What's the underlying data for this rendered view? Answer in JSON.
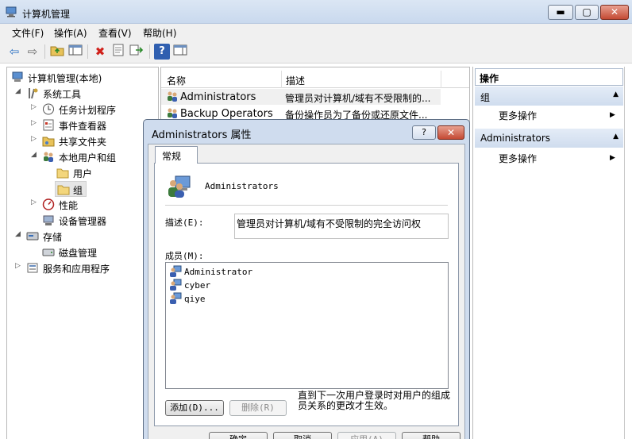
{
  "window": {
    "title": "计算机管理",
    "min_glyph": "▬",
    "max_glyph": "▢",
    "close_glyph": "✕"
  },
  "menu": [
    "文件(F)",
    "操作(A)",
    "查看(V)",
    "帮助(H)"
  ],
  "toolbar": {
    "icons": [
      "back-arrow-icon",
      "forward-arrow-icon",
      "up-folder-icon",
      "show-hide-tree-icon",
      "delete-icon",
      "properties-icon",
      "export-icon",
      "help-icon",
      "action-pane-icon"
    ]
  },
  "tree": {
    "root": "计算机管理(本地)",
    "system_tools": "系统工具",
    "task_scheduler": "任务计划程序",
    "event_viewer": "事件查看器",
    "shared_folders": "共享文件夹",
    "local_users_groups": "本地用户和组",
    "users": "用户",
    "groups": "组",
    "performance": "性能",
    "device_manager": "设备管理器",
    "storage": "存储",
    "disk_management": "磁盘管理",
    "services_apps": "服务和应用程序"
  },
  "list": {
    "col_name": "名称",
    "col_desc": "描述",
    "rows": [
      {
        "name": "Administrators",
        "desc": "管理员对计算机/域有不受限制的..."
      },
      {
        "name": "Backup Operators",
        "desc": "备份操作员为了备份或还原文件..."
      }
    ]
  },
  "actions": {
    "header": "操作",
    "section1": "组",
    "more1": "更多操作",
    "section2": "Administrators",
    "more2": "更多操作"
  },
  "dialog": {
    "title": "Administrators 属性",
    "help_glyph": "?",
    "close_glyph": "✕",
    "tab": "常规",
    "group_name": "Administrators",
    "desc_label": "描述(E):",
    "desc_value": "管理员对计算机/域有不受限制的完全访问权",
    "members_label": "成员(M):",
    "members": [
      "Administrator",
      "cyber",
      "qiye"
    ],
    "add_btn": "添加(D)...",
    "remove_btn": "删除(R)",
    "note": "直到下一次用户登录时对用户的组成员关系的更改才生效。",
    "ok_btn": "确定",
    "cancel_btn": "取消",
    "apply_btn": "应用(A)",
    "help_btn": "帮助"
  }
}
